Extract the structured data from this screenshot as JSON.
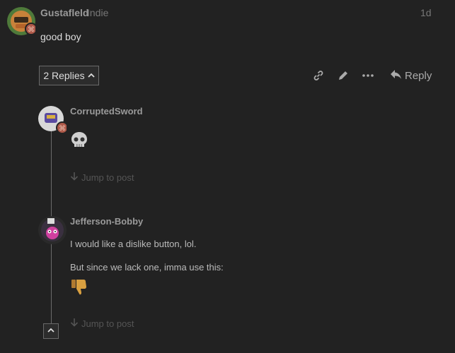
{
  "main_post": {
    "username": "Gustafleld",
    "user_title": "Indie",
    "date": "1d",
    "body": "good boy"
  },
  "post_actions": {
    "replies_label": "2 Replies",
    "reply_label": "Reply"
  },
  "replies": [
    {
      "username": "CorruptedSword",
      "emoji": "skull",
      "jump_label": "Jump to post"
    },
    {
      "username": "Jefferson-Bobby",
      "lines": [
        "I would like a dislike button, lol.",
        "But since we lack one, imma use this:"
      ],
      "emoji": "thumbs-down",
      "jump_label": "Jump to post"
    }
  ]
}
